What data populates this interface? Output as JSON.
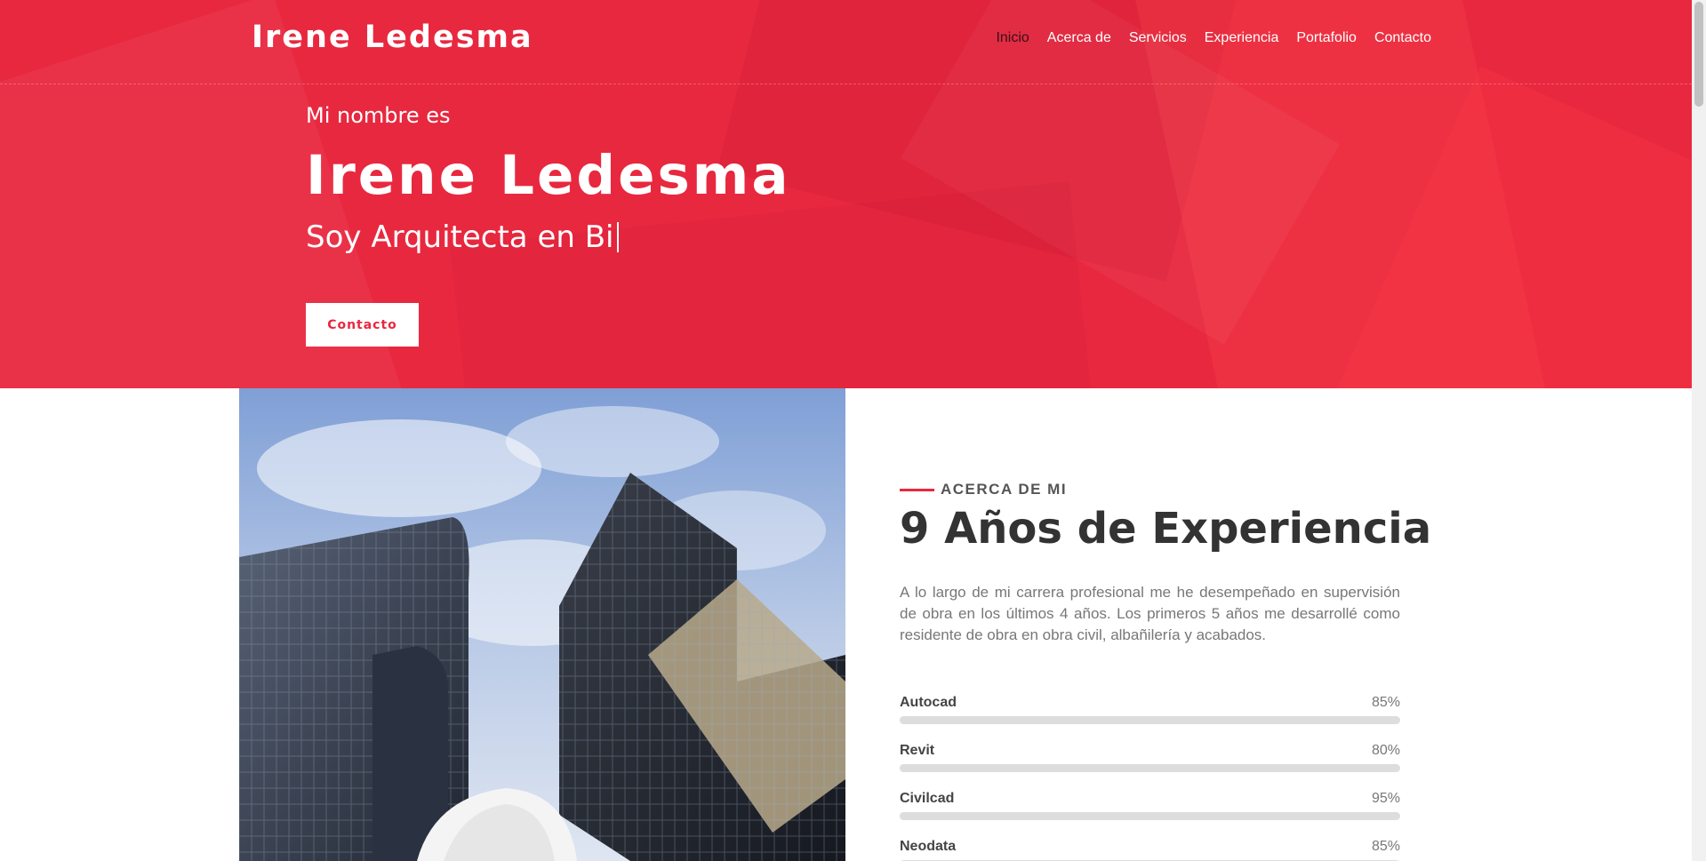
{
  "brand": "Irene Ledesma",
  "nav": {
    "items": [
      {
        "label": "Inicio",
        "active": true
      },
      {
        "label": "Acerca de",
        "active": false
      },
      {
        "label": "Servicios",
        "active": false
      },
      {
        "label": "Experiencia",
        "active": false
      },
      {
        "label": "Portafolio",
        "active": false
      },
      {
        "label": "Contacto",
        "active": false
      }
    ]
  },
  "hero": {
    "intro": "Mi nombre es",
    "name": "Irene Ledesma",
    "role": "Soy Arquitecta en Bi",
    "button": "Contacto"
  },
  "about": {
    "eyebrow": "ACERCA DE MI",
    "title": "9 Años de Experiencia",
    "description": "A lo largo de mi carrera profesional me he desempeñado en supervisión de obra en los últimos 4 años. Los primeros 5 años me desarrollé como residente de obra en obra civil, albañilería y acabados.",
    "skills": [
      {
        "name": "Autocad",
        "value": "85%",
        "level": 0.85
      },
      {
        "name": "Revit",
        "value": "80%",
        "level": 0.8
      },
      {
        "name": "Civilcad",
        "value": "95%",
        "level": 0.95
      },
      {
        "name": "Neodata",
        "value": "85%",
        "level": 0.85
      }
    ]
  },
  "colors": {
    "accent": "#e8283f",
    "text_dark": "#333333",
    "text_muted": "#777777",
    "bar_track": "#dddddd"
  }
}
